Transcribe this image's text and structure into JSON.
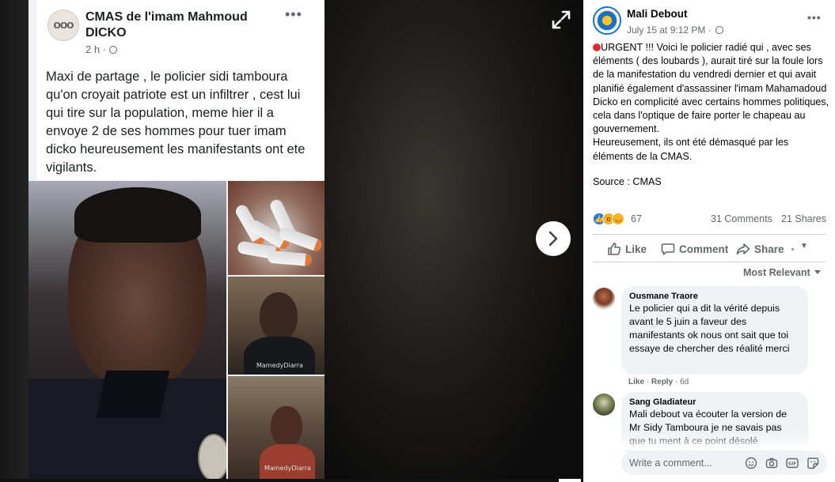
{
  "shared_post": {
    "author": "CMAS de l'imam Mahmoud DICKO",
    "avatar_text": "OOO",
    "time": "2 h ·",
    "more": "•••",
    "text": "Maxi de partage , le policier sidi tamboura qu'on croyait patriote est un infiltrer , cest lui qui tire sur la population,  meme hier il a envoye 2 de ses hommes pour tuer imam dicko heureusement les manifestants ont ete vigilants.",
    "watermarks": [
      "MamedyDiarra",
      "MamedyDiarra"
    ]
  },
  "post": {
    "page_name": "Mali Debout",
    "timestamp": "July 15 at 9:12 PM ·",
    "more": "•••",
    "body": "URGENT !!! Voici le policier radié qui , avec ses éléments ( des loubards ), aurait tiré sur la foule lors de la manifestation du vendredi dernier et qui avait planifié également d'assassiner l'imam Mahamadoud Dicko en complicité avec certains hommes politiques, cela dans l'optique de faire porter le chapeau au gouvernement.\nHeureusement, ils ont été démasqué par les éléments de la CMAS.",
    "source": "Source : CMAS",
    "reaction_count": "67",
    "comments_count": "31 Comments",
    "shares_count": "21 Shares"
  },
  "actions": {
    "like": "Like",
    "comment": "Comment",
    "share": "Share"
  },
  "sort_label": "Most Relevant",
  "comments": [
    {
      "author": "Ousmane Traore",
      "text": "Le policier qui a dit la vérité depuis avant le 5 juin a faveur des manifestants ok nous ont sait que toi essaye de chercher des réalité merci",
      "like": "Like",
      "reply": "Reply",
      "age": "6d"
    },
    {
      "author": "Sang Gladiateur",
      "text": "Mali debout va écouter la version de Mr Sidy Tamboura je ne savais pas que tu ment à ce point désolé"
    }
  ],
  "write_comment_placeholder": "Write a comment...",
  "colors": {
    "facebook_blue": "#1877f2",
    "red_dot": "#e02b2b",
    "reaction_yellow": "#f7b125"
  },
  "icons": [
    "expand-icon",
    "chevron-right-icon",
    "globe-icon",
    "like-icon",
    "comment-icon",
    "share-icon",
    "emoji-icon",
    "camera-icon",
    "gif-icon",
    "sticker-icon"
  ]
}
